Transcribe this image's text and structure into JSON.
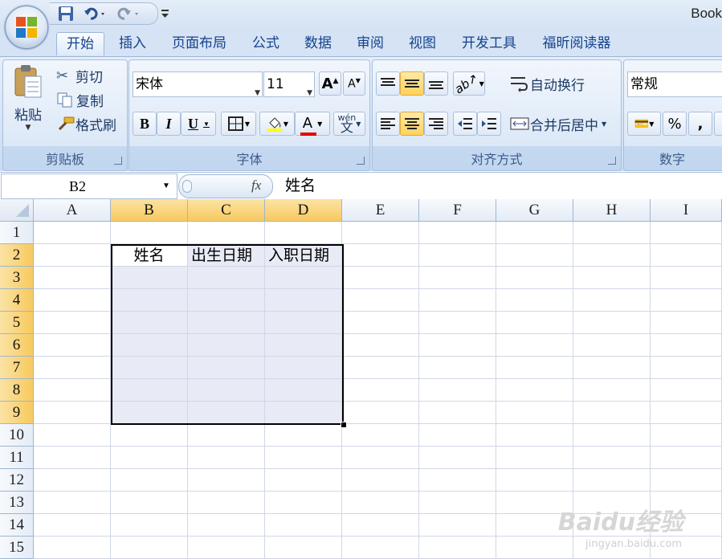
{
  "window": {
    "title": "Book"
  },
  "tabs": [
    "开始",
    "插入",
    "页面布局",
    "公式",
    "数据",
    "审阅",
    "视图",
    "开发工具",
    "福昕阅读器"
  ],
  "clipboard": {
    "paste": "粘贴",
    "cut": "剪切",
    "copy": "复制",
    "format_painter": "格式刷",
    "label": "剪贴板"
  },
  "font": {
    "name": "宋体",
    "size": "11",
    "bold": "B",
    "italic": "I",
    "underline": "U",
    "font_color_glyph": "A",
    "label": "字体"
  },
  "alignment": {
    "wrap_text": "自动换行",
    "merge_center": "合并后居中",
    "label": "对齐方式"
  },
  "number": {
    "format": "常规",
    "percent": "%",
    "comma": ",",
    "label": "数字"
  },
  "formula_bar": {
    "name_box": "B2",
    "fx": "fx",
    "content": "姓名"
  },
  "columns": [
    "A",
    "B",
    "C",
    "D",
    "E",
    "F",
    "G",
    "H",
    "I"
  ],
  "rows": [
    "1",
    "2",
    "3",
    "4",
    "5",
    "6",
    "7",
    "8",
    "9",
    "10",
    "11",
    "12",
    "13",
    "14",
    "15"
  ],
  "cells": {
    "B2": "姓名",
    "C2": "出生日期",
    "D2": "入职日期"
  },
  "watermark": {
    "brand": "Baidu经验",
    "url": "jingyan.baidu.com"
  },
  "colors": {
    "selection_fill": "#e8ebf5",
    "header_selected": "#f8c95e",
    "ribbon_text": "#15428b"
  }
}
